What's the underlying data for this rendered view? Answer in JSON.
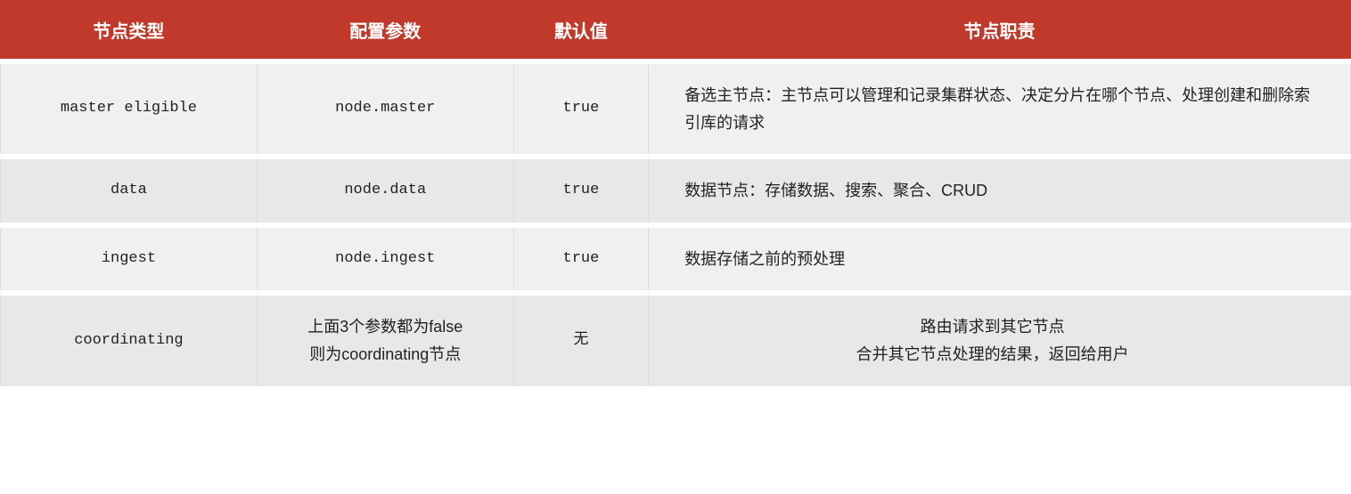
{
  "table": {
    "headers": [
      {
        "key": "type",
        "label": "节点类型"
      },
      {
        "key": "param",
        "label": "配置参数"
      },
      {
        "key": "default",
        "label": "默认值"
      },
      {
        "key": "desc",
        "label": "节点职责"
      }
    ],
    "rows": [
      {
        "type": "master eligible",
        "param": "node.master",
        "default": "true",
        "desc": "备选主节点：主节点可以管理和记录集群状态、决定分片在哪个节点、处理创建和删除索引库的请求",
        "config_multiline": false
      },
      {
        "type": "data",
        "param": "node.data",
        "default": "true",
        "desc": "数据节点：存储数据、搜索、聚合、CRUD",
        "config_multiline": false
      },
      {
        "type": "ingest",
        "param": "node.ingest",
        "default": "true",
        "desc": "数据存储之前的预处理",
        "config_multiline": false
      },
      {
        "type": "coordinating",
        "param_line1": "上面3个参数都为false",
        "param_line2": "则为coordinating节点",
        "default": "无",
        "desc_line1": "路由请求到其它节点",
        "desc_line2": "合并其它节点处理的结果，返回给用户",
        "config_multiline": true
      }
    ],
    "colors": {
      "header_bg": "#c0392b",
      "header_text": "#ffffff",
      "row_odd": "#f0f0f0",
      "row_even": "#e8e8e8",
      "divider": "#ffffff"
    }
  }
}
